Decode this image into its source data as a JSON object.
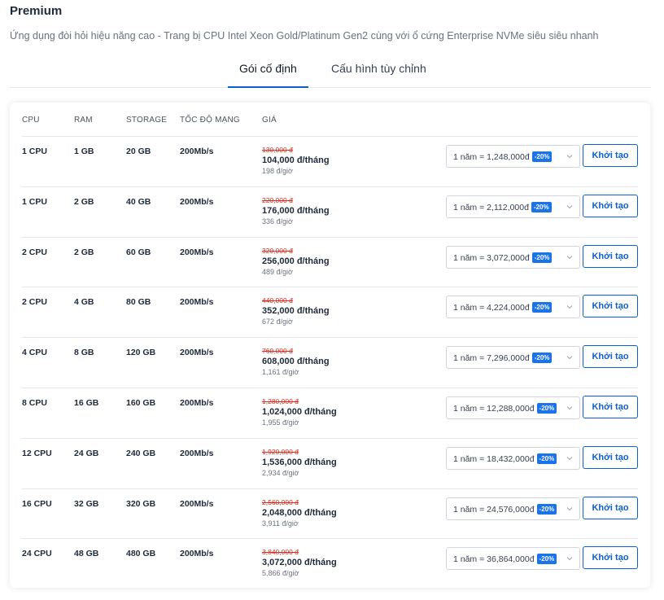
{
  "header": {
    "title": "Premium",
    "subtitle": "Ứng dụng đòi hỏi hiệu năng cao - Trang bị CPU Intel Xeon Gold/Platinum Gen2 cùng với ổ cứng Enterprise NVMe siêu siêu nhanh"
  },
  "tabs": [
    {
      "label": "Gói cố định",
      "active": true
    },
    {
      "label": "Cấu hình tùy chỉnh",
      "active": false
    }
  ],
  "table": {
    "headers": {
      "cpu": "CPU",
      "ram": "RAM",
      "storage": "STORAGE",
      "speed": "TỐC ĐỘ MẠNG",
      "price": "GIÁ"
    },
    "action_label": "Khởi tạo",
    "rows": [
      {
        "cpu": "1 CPU",
        "ram": "1 GB",
        "storage": "20 GB",
        "speed": "200Mb/s",
        "old_price": "130,000 đ",
        "price": "104,000 đ/tháng",
        "hourly": "198 đ/giờ",
        "term": "1 năm = 1,248,000đ",
        "discount": "-20%"
      },
      {
        "cpu": "1 CPU",
        "ram": "2 GB",
        "storage": "40 GB",
        "speed": "200Mb/s",
        "old_price": "220,000 đ",
        "price": "176,000 đ/tháng",
        "hourly": "336 đ/giờ",
        "term": "1 năm = 2,112,000đ",
        "discount": "-20%"
      },
      {
        "cpu": "2 CPU",
        "ram": "2 GB",
        "storage": "60 GB",
        "speed": "200Mb/s",
        "old_price": "320,000 đ",
        "price": "256,000 đ/tháng",
        "hourly": "489 đ/giờ",
        "term": "1 năm = 3,072,000đ",
        "discount": "-20%"
      },
      {
        "cpu": "2 CPU",
        "ram": "4 GB",
        "storage": "80 GB",
        "speed": "200Mb/s",
        "old_price": "440,000 đ",
        "price": "352,000 đ/tháng",
        "hourly": "672 đ/giờ",
        "term": "1 năm = 4,224,000đ",
        "discount": "-20%"
      },
      {
        "cpu": "4 CPU",
        "ram": "8 GB",
        "storage": "120 GB",
        "speed": "200Mb/s",
        "old_price": "760,000 đ",
        "price": "608,000 đ/tháng",
        "hourly": "1,161 đ/giờ",
        "term": "1 năm = 7,296,000đ",
        "discount": "-20%"
      },
      {
        "cpu": "8 CPU",
        "ram": "16 GB",
        "storage": "160 GB",
        "speed": "200Mb/s",
        "old_price": "1,280,000 đ",
        "price": "1,024,000 đ/tháng",
        "hourly": "1,955 đ/giờ",
        "term": "1 năm = 12,288,000đ",
        "discount": "-20%"
      },
      {
        "cpu": "12 CPU",
        "ram": "24 GB",
        "storage": "240 GB",
        "speed": "200Mb/s",
        "old_price": "1,920,000 đ",
        "price": "1,536,000 đ/tháng",
        "hourly": "2,934 đ/giờ",
        "term": "1 năm = 18,432,000đ",
        "discount": "-20%"
      },
      {
        "cpu": "16 CPU",
        "ram": "32 GB",
        "storage": "320 GB",
        "speed": "200Mb/s",
        "old_price": "2,560,000 đ",
        "price": "2,048,000 đ/tháng",
        "hourly": "3,911 đ/giờ",
        "term": "1 năm = 24,576,000đ",
        "discount": "-20%"
      },
      {
        "cpu": "24 CPU",
        "ram": "48 GB",
        "storage": "480 GB",
        "speed": "200Mb/s",
        "old_price": "3,840,000 đ",
        "price": "3,072,000 đ/tháng",
        "hourly": "5,866 đ/giờ",
        "term": "1 năm = 36,864,000đ",
        "discount": "-20%"
      }
    ]
  },
  "colors": {
    "accent": "#0d5fd1",
    "badge": "#1a73e8",
    "old_price": "#d92d20"
  },
  "icons": {
    "select_arrow": "chevron-down-icon"
  }
}
